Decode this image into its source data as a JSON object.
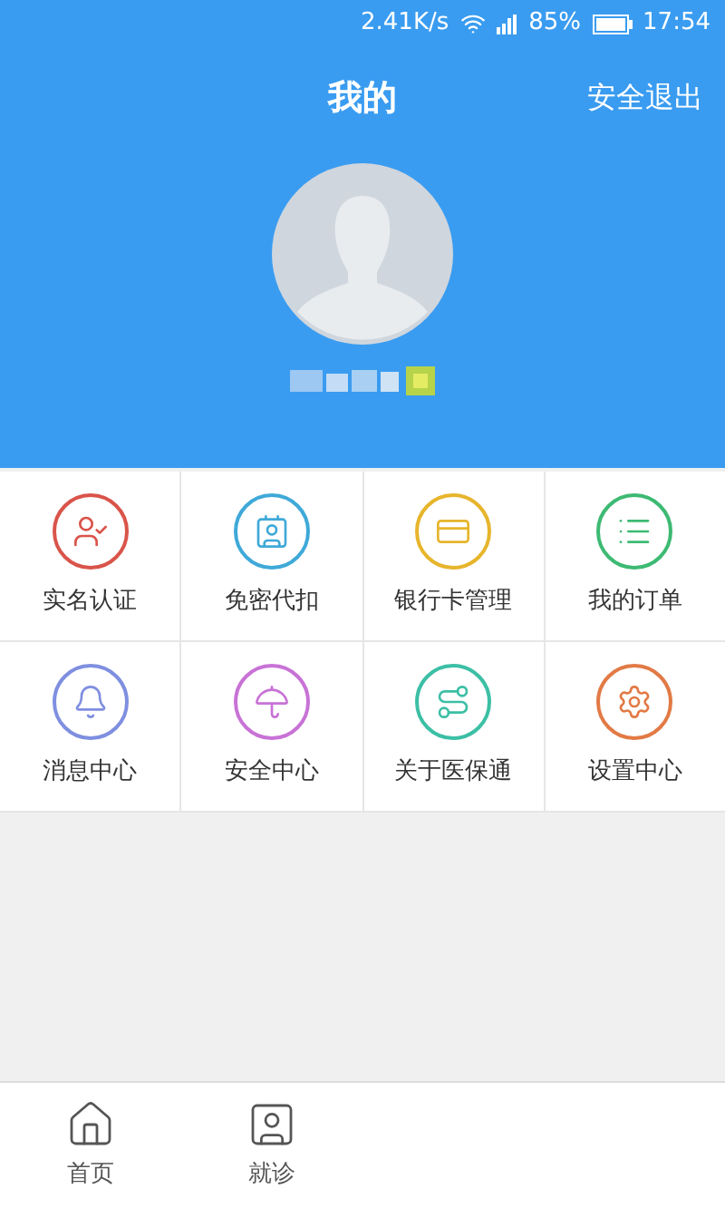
{
  "status_bar": {
    "speed": "2.41K/s",
    "battery": "85%",
    "time": "17:54"
  },
  "header": {
    "title": "我的",
    "logout": "安全退出"
  },
  "menu": [
    {
      "label": "实名认证",
      "color": "#d9544a"
    },
    {
      "label": "免密代扣",
      "color": "#3fa9d8"
    },
    {
      "label": "银行卡管理",
      "color": "#e7b52c"
    },
    {
      "label": "我的订单",
      "color": "#3dba73"
    },
    {
      "label": "消息中心",
      "color": "#7f8fe0"
    },
    {
      "label": "安全中心",
      "color": "#c872d6"
    },
    {
      "label": "关于医保通",
      "color": "#3cbfa5"
    },
    {
      "label": "设置中心",
      "color": "#e27a45"
    }
  ],
  "tab_bar": [
    {
      "label": "首页"
    },
    {
      "label": "就诊"
    }
  ]
}
